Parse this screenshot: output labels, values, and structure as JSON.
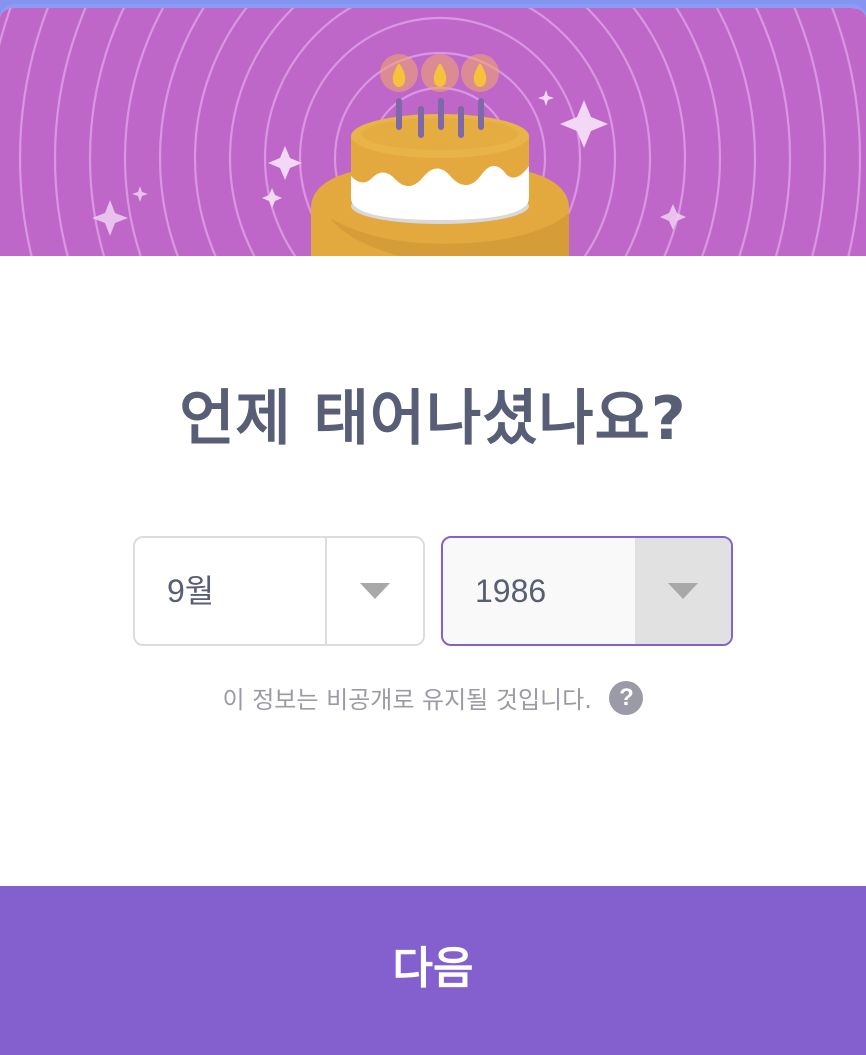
{
  "banner": {
    "illustration": "birthday-cake",
    "background_color": "#bf67c9"
  },
  "title": "언제 태어나셨나요?",
  "month_select": {
    "value": "9월"
  },
  "year_select": {
    "value": "1986"
  },
  "privacy_note": "이 정보는 비공개로 유지될 것입니다.",
  "help_icon": "?",
  "next_button": {
    "label": "다음",
    "color": "#8360cd"
  }
}
